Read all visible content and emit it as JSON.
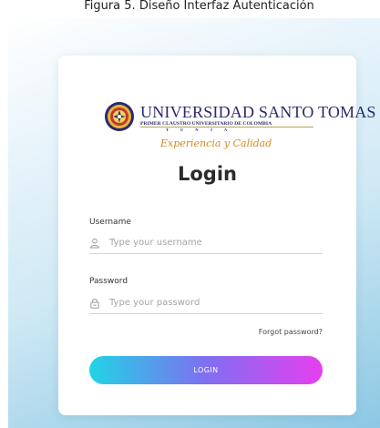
{
  "caption": "Figura 5. Diseño Interfaz Autenticación",
  "logo": {
    "name": "UNIVERSIDAD SANTO TOMAS",
    "subtitle": "PRIMER CLAUSTRO UNIVERSITARIO DE COLOMBIA",
    "city": "T U N J A",
    "tagline": "Experiencia y Calidad"
  },
  "form": {
    "title": "Login",
    "username": {
      "label": "Username",
      "placeholder": "Type your username",
      "value": "",
      "icon": "user-icon"
    },
    "password": {
      "label": "Password",
      "placeholder": "Type your password",
      "value": "",
      "icon": "lock-icon"
    },
    "forgot_label": "Forgot password?",
    "login_label": "LOGIN"
  },
  "colors": {
    "button_gradient": [
      "#21d4e6",
      "#7f6ff0",
      "#e63ff0"
    ],
    "tagline": "#d18c22",
    "brand_navy": "#2a2a6e",
    "background": "#cfe9f5"
  }
}
